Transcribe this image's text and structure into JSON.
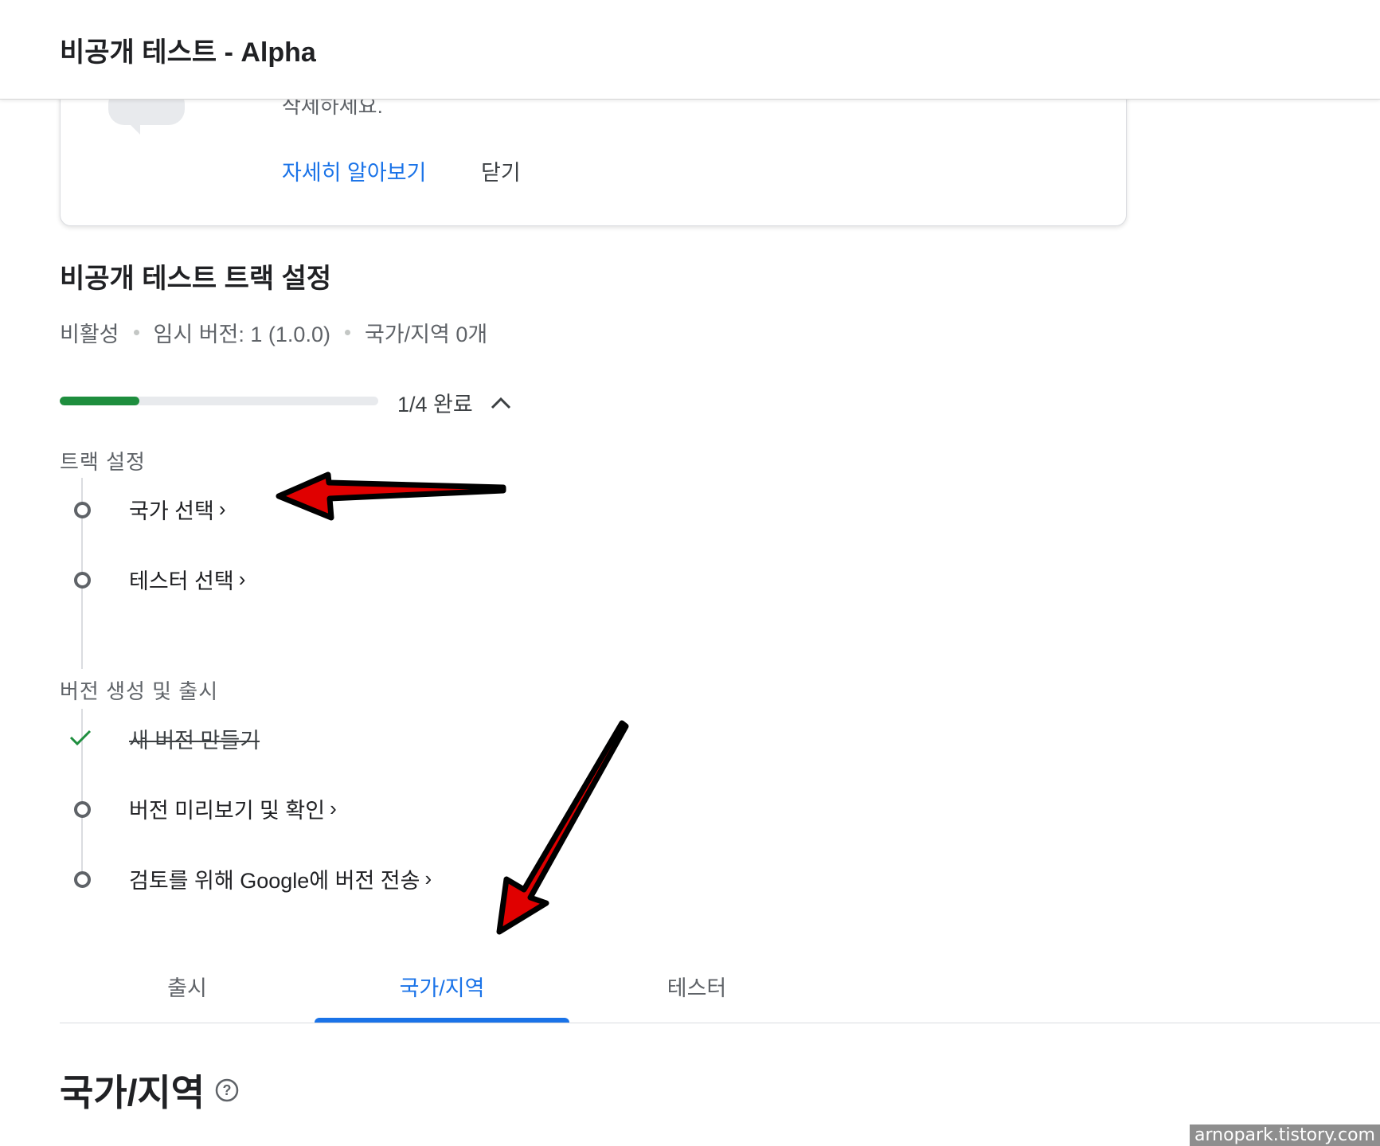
{
  "header": {
    "title": "비공개 테스트 - Alpha"
  },
  "card": {
    "description_partial": "삭제하세요.",
    "learn_more_label": "자세히 알아보기",
    "close_label": "닫기"
  },
  "track": {
    "title": "비공개 테스트 트랙 설정",
    "status": "비활성",
    "release": "임시 버전: 1 (1.0.0)",
    "countries": "국가/지역 0개",
    "progress_label": "1/4 완료",
    "progress_fraction": 0.25
  },
  "groups": {
    "setup": {
      "title": "트랙 설정",
      "steps": [
        "국가 선택",
        "테스터 선택"
      ]
    },
    "release": {
      "title": "버전 생성 및 출시",
      "steps": [
        "새 버전 만들기",
        "버전 미리보기 및 확인",
        "검토를 위해 Google에 버전 전송"
      ]
    }
  },
  "tabs": [
    "출시",
    "국가/지역",
    "테스터"
  ],
  "active_tab": "국가/지역",
  "section_heading": "국가/지역",
  "watermark": "arnopark.tistory.com",
  "colors": {
    "accent": "#1a73e8",
    "progress": "#1e8e3e",
    "annotation_arrow": "#e00000"
  },
  "icons": [
    "chevron-up-icon",
    "chevron-right-icon",
    "check-icon",
    "help-icon",
    "step-circle-icon",
    "annotation-arrow"
  ]
}
